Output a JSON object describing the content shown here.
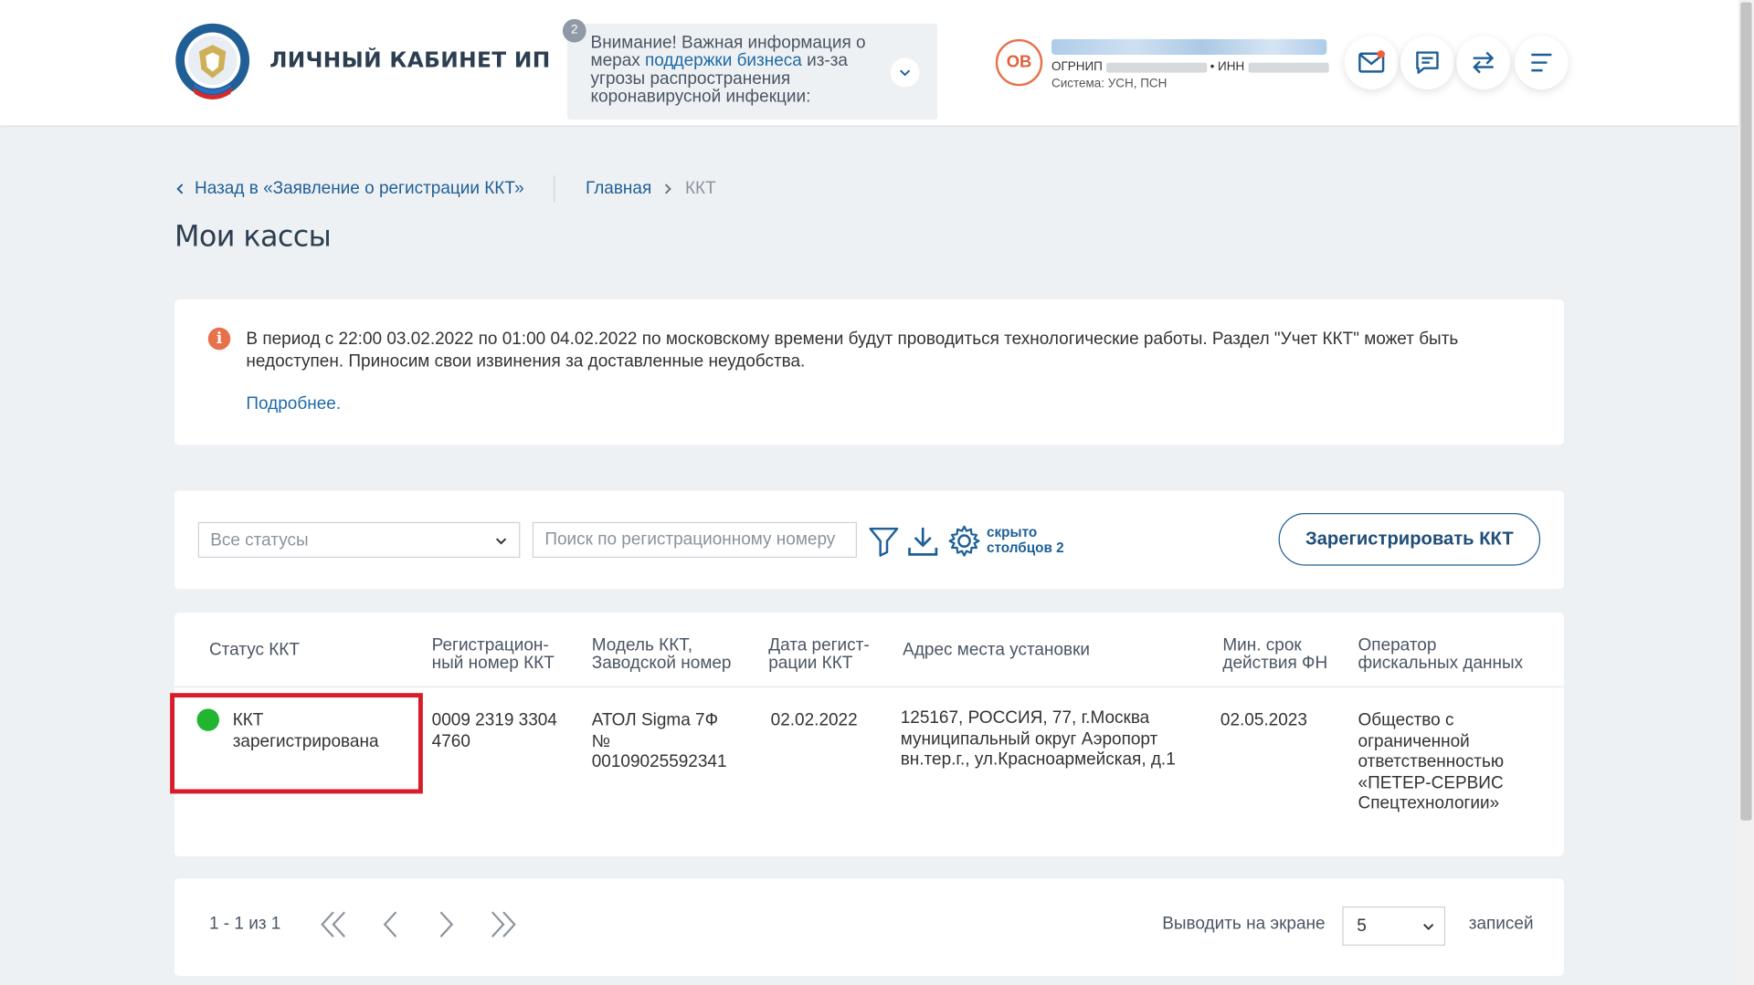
{
  "header": {
    "brand": "ЛИЧНЫЙ КАБИНЕТ ИП",
    "notice_badge": "2",
    "notice_pre": "Внимание! Важная информация о мерах ",
    "notice_link": "поддержки бизнеса",
    "notice_post": " из-за угрозы распространения коронавирусной инфекции:",
    "avatar_initials": "ОВ",
    "ogrnip_label": "ОГРНИП",
    "inn_label": "• ИНН",
    "system_text": "Система: УСН, ПСН",
    "icons": [
      "mail-icon",
      "chat-icon",
      "transfer-icon",
      "menu-icon"
    ],
    "accent_color": "#e8704a",
    "brand_color": "#1f5f96"
  },
  "breadcrumbs": {
    "back": "Назад в «Заявление о регистрации ККТ»",
    "home": "Главная",
    "current": "ККТ"
  },
  "page_title": "Мои кассы",
  "alert": {
    "text": "В период с 22:00 03.02.2022 по 01:00 04.02.2022 по московскому времени будут проводиться технологические работы. Раздел \"Учет ККТ\" может быть недоступен. Приносим свои извинения за доставленные неудобства.",
    "link": "Подробнее."
  },
  "toolbar": {
    "status_filter": "Все статусы",
    "search_placeholder": "Поиск по регистрационному номеру",
    "hidden_columns_line1": "скрыто",
    "hidden_columns_line2": "столбцов 2",
    "register_button": "Зарегистрировать ККТ"
  },
  "table": {
    "headers": [
      "Статус ККТ",
      "Регистрацион-\nный номер ККТ",
      "Модель ККТ,\nЗаводской номер",
      "Дата регист-\nрации ККТ",
      "Адрес места установки",
      "Мин. срок\nдействия ФН",
      "Оператор\nфискальных данных"
    ],
    "rows": [
      {
        "status": "ККТ зарегистрирована",
        "status_color": "#22b530",
        "reg_number": "0009 2319 3304 4760",
        "model": "АТОЛ Sigma 7Ф\n№\n00109025592341",
        "reg_date": "02.02.2022",
        "address": "125167, РОССИЯ, 77, г.Москва муниципальный округ Аэропорт вн.тер.г., ул.Красноармейская, д.1",
        "fn_term": "02.05.2023",
        "operator": "Общество с ограниченной ответственностью «ПЕТЕР-СЕРВИС Спецтехнологии»"
      }
    ]
  },
  "pagination": {
    "range": "1 - 1 из 1",
    "per_page_label": "Выводить на экране",
    "per_page_value": "5",
    "records_label": "записей"
  }
}
